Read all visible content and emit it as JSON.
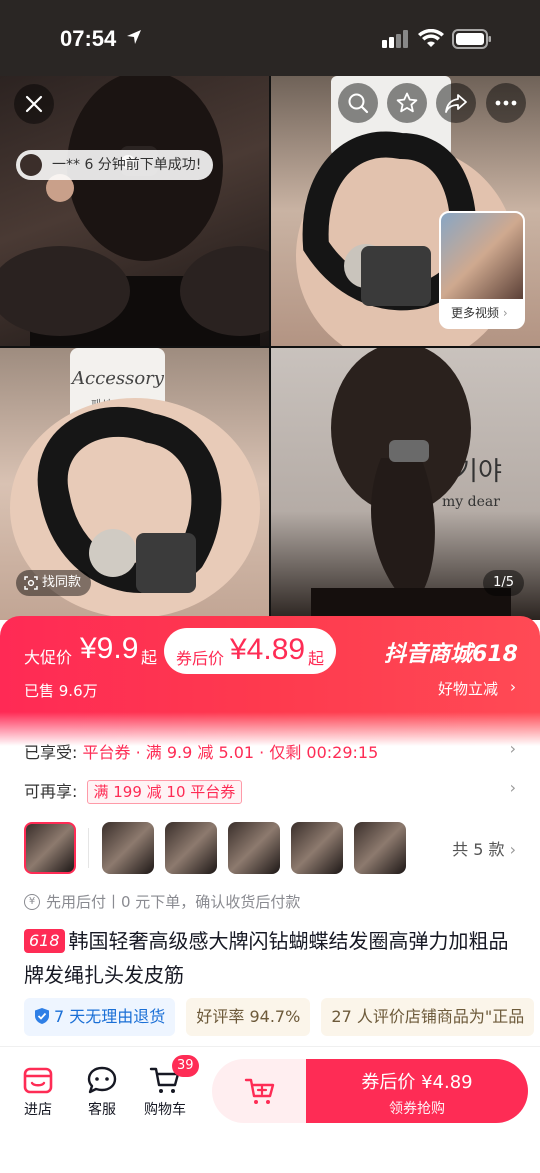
{
  "status": {
    "time": "07:54"
  },
  "gallery": {
    "toast": "一** 6 分钟前下单成功!",
    "more_videos": "更多视频",
    "find_same": "找同款",
    "pager": "1/5",
    "package_label": "Accessory",
    "package_sub": "패션 주얼리",
    "wall_text": "가기야",
    "wall_text2": "my dear"
  },
  "promo": {
    "big_promo_label": "大促价",
    "big_promo_price": "¥9.9",
    "big_promo_suffix": "起",
    "after_coupon_label": "券后价",
    "after_coupon_price": "¥4.89",
    "after_coupon_suffix": "起",
    "sold": "已售 9.6万",
    "mall_title": "抖音商城618",
    "mall_sub": "好物立减"
  },
  "rows": {
    "enjoyed_label": "已享受:",
    "enjoyed_value": "平台券 · 满 9.9 减 5.01 · 仅剩 00:29:15",
    "more_label": "可再享:",
    "more_coupon": "满 199 减 10 平台券"
  },
  "variants": {
    "count_label": "共 5 款"
  },
  "paylater": {
    "text": "先用后付丨0 元下单，确认收货后付款"
  },
  "product": {
    "tag": "618",
    "title": "韩国轻奢高级感大牌闪钻蝴蝶结发圈高弹力加粗品牌发绳扎头发皮筋"
  },
  "chips": {
    "return_policy": "7 天无理由退货",
    "rating": "好评率 94.7%",
    "reviews": "27 人评价店铺商品为\"正品"
  },
  "bottom": {
    "store": "进店",
    "service": "客服",
    "cart": "购物车",
    "cart_badge": "39",
    "buy_title": "券后价 ¥4.89",
    "buy_sub": "领券抢购"
  }
}
